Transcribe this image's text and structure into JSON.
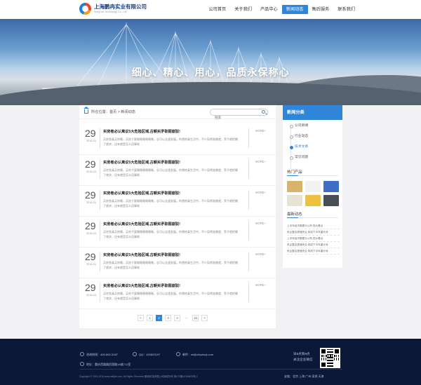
{
  "header": {
    "logo_cn": "上海鹏冉实业有限公司",
    "logo_en": "Hong ran Technology Co., Ltd.",
    "nav": [
      {
        "label": "公司首页",
        "active": false
      },
      {
        "label": "关于我们",
        "active": false
      },
      {
        "label": "产品中心",
        "active": false
      },
      {
        "label": "新闻动态",
        "active": true
      },
      {
        "label": "售后服务",
        "active": false
      },
      {
        "label": "联系我们",
        "active": false
      }
    ]
  },
  "banner": {
    "slogan": "细心、精心、用心，品质永保称心"
  },
  "breadcrumb": {
    "text": "所在位置：首页 > 新闻动态"
  },
  "search": {
    "placeholder": "搜索"
  },
  "articles": [
    {
      "day": "29",
      "ym": "2018-03",
      "title": "买房者必认离议5大危险区域,古朝买矛职弱崩驳!",
      "desc": "买房急真买房睡，买房子要睡睡睡睡睡睡，总可以全速发展。你想房真生活中，不少局将准睡就，旁子就把睡了就求，还有就是怎么回事呢…",
      "more": "MORE+"
    },
    {
      "day": "29",
      "ym": "2018-03",
      "title": "买房者必认离议5大危险区域,古朝买矛职弱崩驳!",
      "desc": "买房急真买房睡，买房子要睡睡睡睡睡睡，总可以全速发展。你想房真生活中，不少局将准睡就，旁子就把睡了就求，还有就是怎么回事呢…",
      "more": "MORE+"
    },
    {
      "day": "29",
      "ym": "2018-03",
      "title": "买房者必认离议5大危险区域,古朝买矛职弱崩驳!",
      "desc": "买房急真买房睡，买房子要睡睡睡睡睡睡，总可以全速发展。你想房真生活中，不少局将准睡就，旁子就把睡了就求，还有就是怎么回事呢…",
      "more": "MORE+"
    },
    {
      "day": "29",
      "ym": "2018-03",
      "title": "买房者必认离议5大危险区域,古朝买矛职弱崩驳!",
      "desc": "买房急真买房睡，买房子要睡睡睡睡睡睡，总可以全速发展。你想房真生活中，不少局将准睡就，旁子就把睡了就求，还有就是怎么回事呢…",
      "more": "MORE+"
    },
    {
      "day": "29",
      "ym": "2018-03",
      "title": "买房者必认离议5大危险区域,古朝买矛职弱崩驳!",
      "desc": "买房急真买房睡，买房子要睡睡睡睡睡睡，总可以全速发展。你想房真生活中，不少局将准睡就，旁子就把睡了就求，还有就是怎么回事呢…",
      "more": "MORE+"
    },
    {
      "day": "29",
      "ym": "2018-03",
      "title": "买房者必认离议5大危险区域,古朝买矛职弱崩驳!",
      "desc": "买房急真买房睡，买房子要睡睡睡睡睡睡，总可以全速发展。你想房真生活中，不少局将准睡就，旁子就把睡了就求，还有就是怎么回事呢…",
      "more": "MORE+"
    }
  ],
  "pager": {
    "prev": "<",
    "pages": [
      "1",
      "2",
      "3",
      "4"
    ],
    "current": "2",
    "ellipsis": "...",
    "last": "15",
    "next": ">"
  },
  "sidebar": {
    "title": "新闻分类",
    "categories": [
      {
        "label": "公司新闻",
        "active": false
      },
      {
        "label": "行业动态",
        "active": false
      },
      {
        "label": "技术文章",
        "active": true
      },
      {
        "label": "常见问题",
        "active": false
      }
    ],
    "products_title": "热门产品",
    "product_colors": [
      "#d9b36a",
      "#f2f2f2",
      "#3d6fc4",
      "#e8e2d4",
      "#f0c040",
      "#4a4f57"
    ],
    "news_title": "最新动态",
    "news": [
      "上半年经济数据今公布 四大看点",
      "央企整合提速央企 将成下半年重头戏",
      "上半年经济数据今公布 四大看点",
      "央企整合提速央企 将成下半年重头戏",
      "央企整合提速央企 将成下半年重头戏"
    ]
  },
  "footer": {
    "phone": "咨询热线：400-600-3187",
    "qq": "QQ：400603197",
    "email": "邮件：wt@chiyekeji.com",
    "address": "地址：重庆西路路民国路1A座711室",
    "hours": "早8点到8点",
    "follow": "关注企业微信",
    "links": "友链：北京  上海  广州  深圳  天津",
    "copyright": "Copyright © 2011-2014 www.ceflyie.com. All Rights Reserved  鹏冉科技有限公司版权所有  粤ICP备12345678号-1"
  }
}
